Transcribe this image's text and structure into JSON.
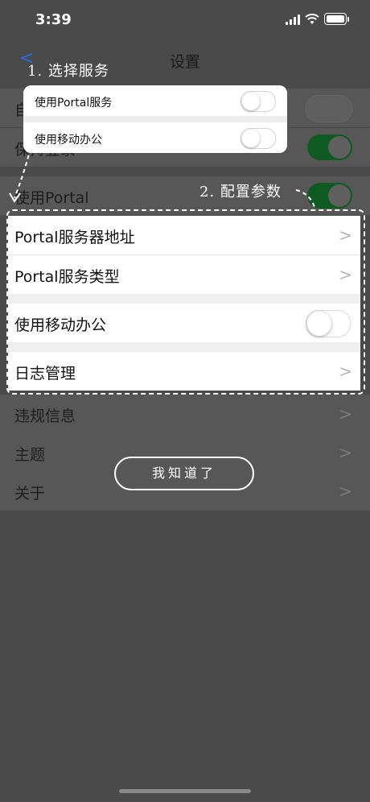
{
  "status_bar": {
    "time": "3:39"
  },
  "nav": {
    "back_icon": "<",
    "title": "设置"
  },
  "background_list": {
    "row_auto": "自",
    "row_keep": "保持登录",
    "row_portal": "使用Portal",
    "row_violation": "违规信息",
    "row_theme": "主题",
    "row_about": "关于"
  },
  "chevron": ">",
  "popup": {
    "rows": [
      {
        "label": "使用Portal服务"
      },
      {
        "label": "使用移动办公"
      }
    ]
  },
  "annotations": {
    "step1": "1. 选择服务",
    "step2": "2. 配置参数"
  },
  "panel": {
    "portal_address": "Portal服务器地址",
    "portal_type": "Portal服务类型",
    "mobile_office": "使用移动办公",
    "log_management": "日志管理"
  },
  "got_it_button": "我知道了",
  "colors": {
    "overlay": "#4a4a4a",
    "toggle_on_dim": "#0e5a22",
    "accent": "#2a6bd6"
  }
}
